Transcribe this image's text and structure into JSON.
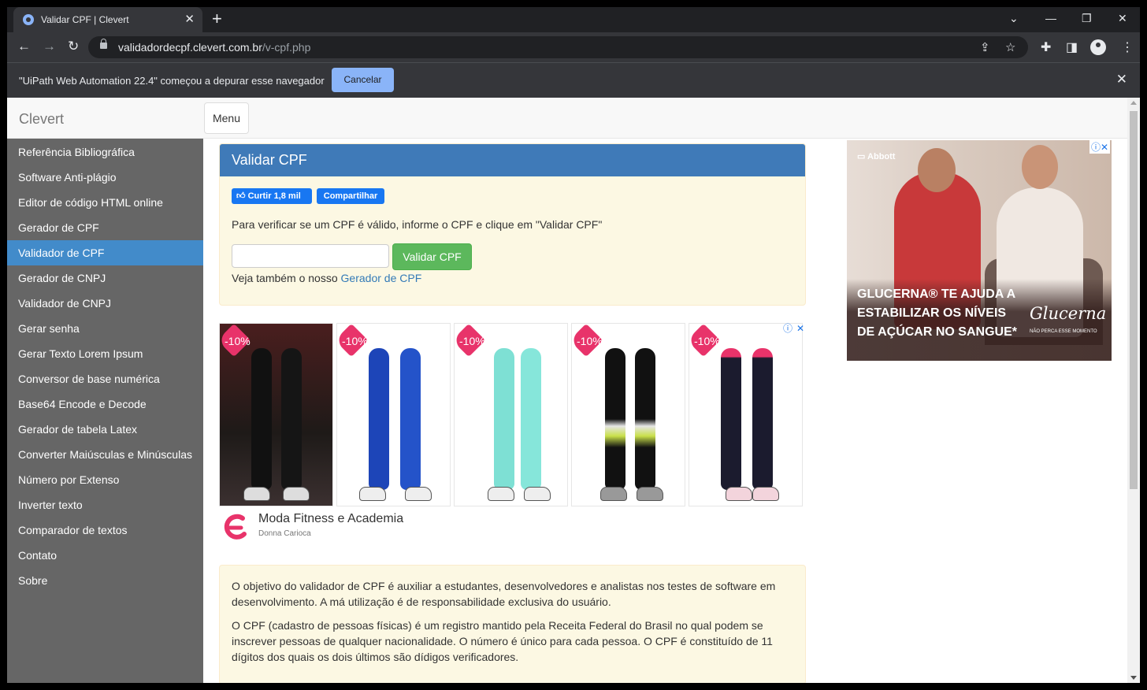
{
  "browser": {
    "tab_title": "Validar CPF | Clevert",
    "url_host": "validadordecpf.clevert.com.br",
    "url_path": "/v-cpf.php"
  },
  "infobar": {
    "message": "\"UiPath Web Automation 22.4\" começou a depurar esse navegador",
    "cancel_label": "Cancelar"
  },
  "site": {
    "brand": "Clevert",
    "menu_label": "Menu"
  },
  "sidebar": {
    "active_index": 4,
    "items": [
      {
        "label": "Referência Bibliográfica"
      },
      {
        "label": "Software Anti-plágio"
      },
      {
        "label": "Editor de código HTML online"
      },
      {
        "label": "Gerador de CPF"
      },
      {
        "label": "Validador de CPF"
      },
      {
        "label": "Gerador de CNPJ"
      },
      {
        "label": "Validador de CNPJ"
      },
      {
        "label": "Gerar senha"
      },
      {
        "label": "Gerar Texto Lorem Ipsum"
      },
      {
        "label": "Conversor de base numérica"
      },
      {
        "label": "Base64 Encode e Decode"
      },
      {
        "label": "Gerador de tabela Latex"
      },
      {
        "label": "Converter Maiúsculas e Minúsculas"
      },
      {
        "label": "Número por Extenso"
      },
      {
        "label": "Inverter texto"
      },
      {
        "label": "Comparador de textos"
      },
      {
        "label": "Contato"
      },
      {
        "label": "Sobre"
      }
    ]
  },
  "validator": {
    "heading": "Validar CPF",
    "fb_like": "Curtir 1,8 mil",
    "fb_share": "Compartilhar",
    "instructions": "Para verificar se um CPF é válido, informe o CPF e clique em \"Validar CPF\"",
    "input_value": "",
    "button_label": "Validar CPF",
    "see_also_prefix": "Veja também o nosso",
    "see_also_link": "Gerador de CPF"
  },
  "ad_strip": {
    "discount": "-10%",
    "advertiser": "Moda Fitness e Academia",
    "advertiser_sub": "Donna Carioca"
  },
  "about": {
    "p1": "O objetivo do validador de CPF é auxiliar a estudantes, desenvolvedores e analistas nos testes de software em desenvolvimento. A má utilização é de responsabilidade exclusiva do usuário.",
    "p2": "O CPF (cadastro de pessoas físicas) é um registro mantido pela Receita Federal do Brasil no qual podem se inscrever pessoas de qualquer nacionalidade. O número é único para cada pessoa. O CPF é constituído de 11 dígitos dos quais os dois últimos são dídigos verificadores."
  },
  "side_ad": {
    "company": "Abbott",
    "headline": "GLUCERNA® TE AJUDA A ESTABILIZAR OS NÍVEIS DE AÇÚCAR NO SANGUE*",
    "brand": "Glucerna",
    "tagline": "NÃO PERCA ESSE MOMENTO"
  }
}
